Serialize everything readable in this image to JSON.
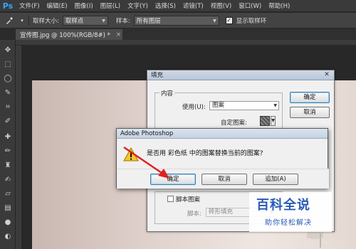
{
  "menu": {
    "logo": "Ps",
    "items": [
      "文件(F)",
      "编辑(E)",
      "图像(I)",
      "图层(L)",
      "文字(Y)",
      "选择(S)",
      "滤镜(T)",
      "视图(V)",
      "窗口(W)",
      "帮助(H)"
    ]
  },
  "options": {
    "tool_icon": "eyedropper-icon",
    "sample_size_label": "取样大小:",
    "sample_size_value": "取样点",
    "sample_label": "样本:",
    "sample_value": "所有图层",
    "show_ring_label": "显示取样环",
    "show_ring_checked": true
  },
  "document": {
    "tab_label": "宣传图.jpg @ 100%(RGB/8#) *",
    "close": "×"
  },
  "fill_dialog": {
    "title": "填充",
    "content_group": "内容",
    "use_label": "使用(U):",
    "use_value": "图案",
    "custom_pattern_label": "自定图案:",
    "ok": "确定",
    "cancel": "取消",
    "script_checkbox_label": "脚本图案",
    "script_label": "脚本:",
    "script_value": "砖形填充"
  },
  "alert": {
    "title": "Adobe Photoshop",
    "message": "是否用 彩色纸 中的图案替换当前的图案?",
    "ok": "确定",
    "cancel": "取消",
    "append": "追加(A)"
  },
  "watermark": {
    "main": "百科全说",
    "sub": "助你轻松解决"
  },
  "colors": {
    "accent_blue": "#2a5bb7",
    "annotation_red": "#e02020"
  }
}
